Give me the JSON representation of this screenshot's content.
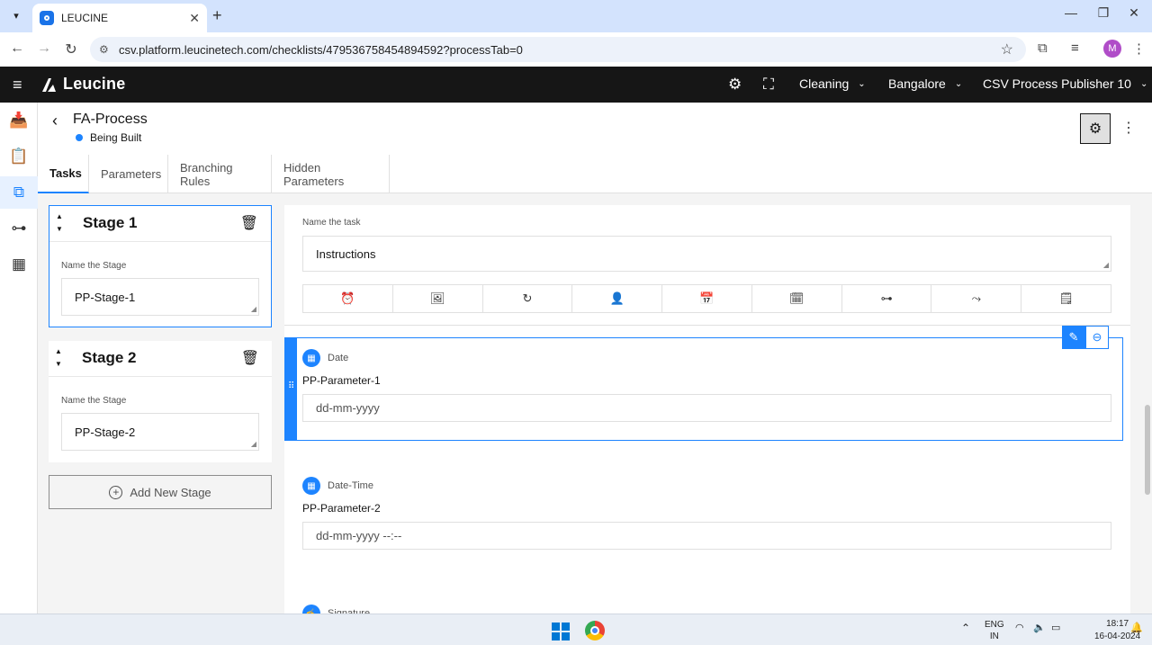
{
  "browser": {
    "tab_title": "LEUCINE",
    "url": "csv.platform.leucinetech.com/checklists/479536758454894592?processTab=0"
  },
  "profile_initial": "M",
  "header": {
    "logo_text": "Leucine",
    "facility": "Cleaning",
    "location": "Bangalore",
    "user_role": "CSV Process Publisher 10"
  },
  "process": {
    "title": "FA-Process",
    "status": "Being Built"
  },
  "tabs": [
    "Tasks",
    "Parameters",
    "Branching Rules",
    "Hidden Parameters"
  ],
  "stages": [
    {
      "title": "Stage 1",
      "label": "Name the Stage",
      "value": "PP-Stage-1"
    },
    {
      "title": "Stage 2",
      "label": "Name the Stage",
      "value": "PP-Stage-2"
    }
  ],
  "add_stage_label": "Add New Stage",
  "task": {
    "name_label": "Name the task",
    "name_value": "Instructions"
  },
  "parameters": [
    {
      "type": "Date",
      "name": "PP-Parameter-1",
      "placeholder": "dd-mm-yyyy"
    },
    {
      "type": "Date-Time",
      "name": "PP-Parameter-2",
      "placeholder": "dd-mm-yyyy --:--"
    },
    {
      "type": "Signature"
    }
  ],
  "taskbar": {
    "lang_top": "ENG",
    "lang_bottom": "IN",
    "time": "18:17",
    "date": "16-04-2024"
  },
  "colors": {
    "accent": "#1d84ff",
    "header_bg": "#161616"
  }
}
